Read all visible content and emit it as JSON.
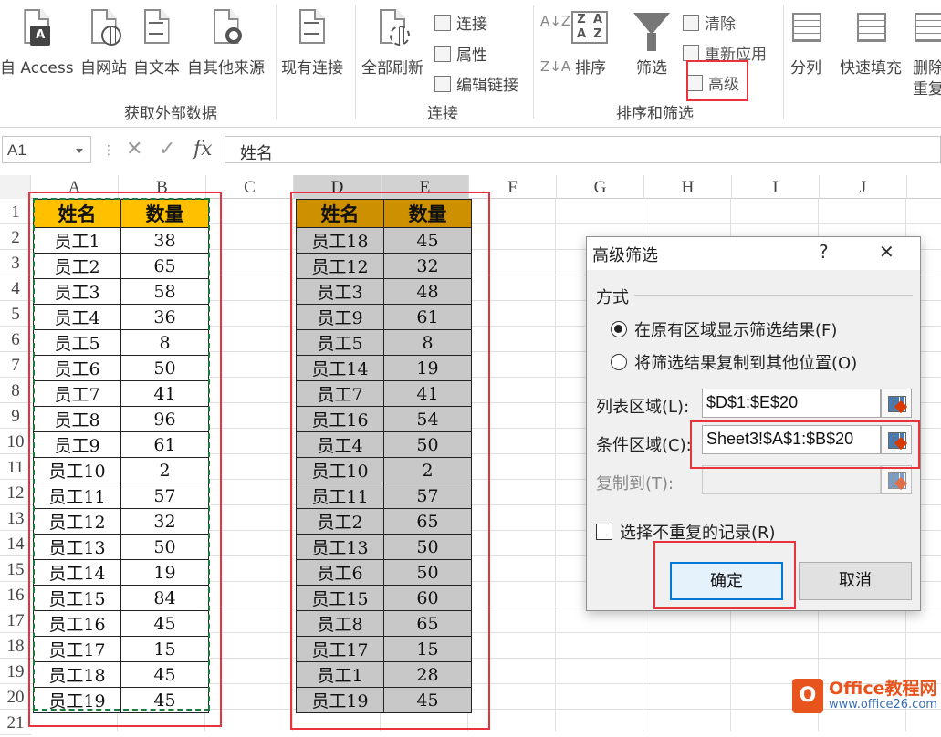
{
  "ribbon": {
    "get_external": {
      "buttons": [
        "自 Access",
        "自网站",
        "自文本",
        "自其他来源",
        "现有连接"
      ],
      "group_label": "获取外部数据"
    },
    "connections": {
      "refresh_all": "全部刷新",
      "connections": "连接",
      "properties": "属性",
      "edit_links": "编辑链接",
      "group_label": "连接"
    },
    "sort_filter": {
      "sort": "排序",
      "filter": "筛选",
      "clear": "清除",
      "reapply": "重新应用",
      "advanced": "高级",
      "group_label": "排序和筛选"
    },
    "data_tools": {
      "text_to_columns": "分列",
      "flash_fill": "快速填充",
      "remove_dup_1": "删除",
      "remove_dup_2": "重复"
    }
  },
  "formula_bar": {
    "name_box": "A1",
    "formula": "姓名",
    "fx": "fx"
  },
  "columns": [
    "A",
    "B",
    "C",
    "D",
    "E",
    "F",
    "G",
    "H",
    "I",
    "J"
  ],
  "rows": [
    "1",
    "2",
    "3",
    "4",
    "5",
    "6",
    "7",
    "8",
    "9",
    "10",
    "11",
    "12",
    "13",
    "14",
    "15",
    "16",
    "17",
    "18",
    "19",
    "20",
    "21"
  ],
  "tableA": {
    "headers": [
      "姓名",
      "数量"
    ],
    "rows": [
      [
        "员工1",
        "38"
      ],
      [
        "员工2",
        "65"
      ],
      [
        "员工3",
        "58"
      ],
      [
        "员工4",
        "36"
      ],
      [
        "员工5",
        "8"
      ],
      [
        "员工6",
        "50"
      ],
      [
        "员工7",
        "41"
      ],
      [
        "员工8",
        "96"
      ],
      [
        "员工9",
        "61"
      ],
      [
        "员工10",
        "2"
      ],
      [
        "员工11",
        "57"
      ],
      [
        "员工12",
        "32"
      ],
      [
        "员工13",
        "50"
      ],
      [
        "员工14",
        "19"
      ],
      [
        "员工15",
        "84"
      ],
      [
        "员工16",
        "45"
      ],
      [
        "员工17",
        "15"
      ],
      [
        "员工18",
        "45"
      ],
      [
        "员工19",
        "45"
      ]
    ]
  },
  "tableD": {
    "headers": [
      "姓名",
      "数量"
    ],
    "rows": [
      [
        "员工18",
        "45"
      ],
      [
        "员工12",
        "32"
      ],
      [
        "员工3",
        "48"
      ],
      [
        "员工9",
        "61"
      ],
      [
        "员工5",
        "8"
      ],
      [
        "员工14",
        "19"
      ],
      [
        "员工7",
        "41"
      ],
      [
        "员工16",
        "54"
      ],
      [
        "员工4",
        "50"
      ],
      [
        "员工10",
        "2"
      ],
      [
        "员工11",
        "57"
      ],
      [
        "员工2",
        "65"
      ],
      [
        "员工13",
        "50"
      ],
      [
        "员工6",
        "50"
      ],
      [
        "员工15",
        "60"
      ],
      [
        "员工8",
        "65"
      ],
      [
        "员工17",
        "15"
      ],
      [
        "员工1",
        "28"
      ],
      [
        "员工19",
        "45"
      ]
    ]
  },
  "dialog": {
    "title": "高级筛选",
    "help": "?",
    "close": "✕",
    "section": "方式",
    "option1": "在原有区域显示筛选结果(F)",
    "option2": "将筛选结果复制到其他位置(O)",
    "list_range_label": "列表区域(L):",
    "list_range_value": "$D$1:$E$20",
    "criteria_range_label": "条件区域(C):",
    "criteria_range_value": "Sheet3!$A$1:$B$20",
    "copy_to_label": "复制到(T):",
    "copy_to_value": "",
    "unique_label": "选择不重复的记录(R)",
    "ok": "确定",
    "cancel": "取消"
  },
  "watermark": {
    "logo": "O",
    "line1": "Office教程网",
    "line2": "www.office26.com"
  },
  "colors": {
    "header_a": "#ffc000",
    "header_d": "#cc9000",
    "highlight_red": "#e8323c",
    "marching_ants": "#1b7a3c"
  }
}
